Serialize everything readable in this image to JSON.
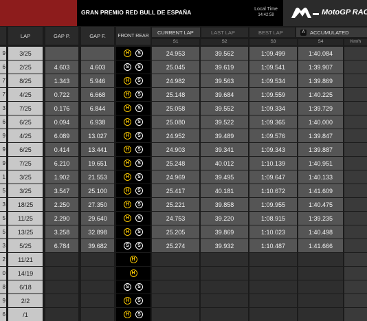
{
  "header": {
    "event_title": "GRAN PREMIO RED BULL DE ESPAÑA",
    "local_time_label": "Local Time",
    "local_time_value": "14:42:58",
    "brand": "MotoGP RAC"
  },
  "columns": {
    "lap": "LAP",
    "gap_prev": "GAP P.",
    "gap_first": "GAP F.",
    "tyres": "FRONT REAR",
    "sectors": [
      "S1",
      "S2",
      "S3",
      "S4"
    ],
    "speed": "Km/h"
  },
  "tabs": {
    "current": "CURRENT LAP",
    "last": "LAST LAP",
    "best": "BEST LAP",
    "accumulated": "ACCUMULATED",
    "accum_icon": "A"
  },
  "colors": {
    "hard_tyre": "#f5c400",
    "soft_tyre": "#ffffff",
    "brand_red": "#8d1c1c"
  },
  "rows": [
    {
      "stub": "9",
      "lap": "3/25",
      "gap_p": "",
      "gap_f": "",
      "front": "H",
      "rear": "S",
      "s1": "24.953",
      "s2": "39.562",
      "s3": "1:09.499",
      "s4": "1:40.084"
    },
    {
      "stub": "6",
      "lap": "2/25",
      "gap_p": "4.603",
      "gap_f": "4.603",
      "front": "S",
      "rear": "S",
      "s1": "25.045",
      "s2": "39.619",
      "s3": "1:09.541",
      "s4": "1:39.907"
    },
    {
      "stub": "7",
      "lap": "8/25",
      "gap_p": "1.343",
      "gap_f": "5.946",
      "front": "H",
      "rear": "S",
      "s1": "24.982",
      "s2": "39.563",
      "s3": "1:09.534",
      "s4": "1:39.869"
    },
    {
      "stub": "7",
      "lap": "4/25",
      "gap_p": "0.722",
      "gap_f": "6.668",
      "front": "H",
      "rear": "S",
      "s1": "25.148",
      "s2": "39.684",
      "s3": "1:09.559",
      "s4": "1:40.225"
    },
    {
      "stub": "3",
      "lap": "7/25",
      "gap_p": "0.176",
      "gap_f": "6.844",
      "front": "H",
      "rear": "S",
      "s1": "25.058",
      "s2": "39.552",
      "s3": "1:09.334",
      "s4": "1:39.729"
    },
    {
      "stub": "6",
      "lap": "6/25",
      "gap_p": "0.094",
      "gap_f": "6.938",
      "front": "H",
      "rear": "S",
      "s1": "25.080",
      "s2": "39.522",
      "s3": "1:09.365",
      "s4": "1:40.000"
    },
    {
      "stub": "9",
      "lap": "4/25",
      "gap_p": "6.089",
      "gap_f": "13.027",
      "front": "H",
      "rear": "S",
      "s1": "24.952",
      "s2": "39.489",
      "s3": "1:09.576",
      "s4": "1:39.847"
    },
    {
      "stub": "9",
      "lap": "6/25",
      "gap_p": "0.414",
      "gap_f": "13.441",
      "front": "H",
      "rear": "S",
      "s1": "24.903",
      "s2": "39.341",
      "s3": "1:09.343",
      "s4": "1:39.887"
    },
    {
      "stub": "9",
      "lap": "7/25",
      "gap_p": "6.210",
      "gap_f": "19.651",
      "front": "H",
      "rear": "S",
      "s1": "25.248",
      "s2": "40.012",
      "s3": "1:10.139",
      "s4": "1:40.951"
    },
    {
      "stub": "1",
      "lap": "3/25",
      "gap_p": "1.902",
      "gap_f": "21.553",
      "front": "H",
      "rear": "S",
      "s1": "24.969",
      "s2": "39.495",
      "s3": "1:09.647",
      "s4": "1:40.133"
    },
    {
      "stub": "5",
      "lap": "3/25",
      "gap_p": "3.547",
      "gap_f": "25.100",
      "front": "H",
      "rear": "S",
      "s1": "25.417",
      "s2": "40.181",
      "s3": "1:10.672",
      "s4": "1:41.609"
    },
    {
      "stub": "3",
      "lap": "18/25",
      "gap_p": "2.250",
      "gap_f": "27.350",
      "front": "H",
      "rear": "S",
      "s1": "25.221",
      "s2": "39.858",
      "s3": "1:09.955",
      "s4": "1:40.475"
    },
    {
      "stub": "5",
      "lap": "11/25",
      "gap_p": "2.290",
      "gap_f": "29.640",
      "front": "H",
      "rear": "S",
      "s1": "24.753",
      "s2": "39.220",
      "s3": "1:08.915",
      "s4": "1:39.235"
    },
    {
      "stub": "5",
      "lap": "13/25",
      "gap_p": "3.258",
      "gap_f": "32.898",
      "front": "H",
      "rear": "S",
      "s1": "25.205",
      "s2": "39.869",
      "s3": "1:10.023",
      "s4": "1:40.498"
    },
    {
      "stub": "3",
      "lap": "5/25",
      "gap_p": "6.784",
      "gap_f": "39.682",
      "front": "S",
      "rear": "S",
      "s1": "25.274",
      "s2": "39.932",
      "s3": "1:10.487",
      "s4": "1:41.666"
    },
    {
      "stub": "2",
      "lap": "11/21",
      "gap_p": "",
      "gap_f": "",
      "front": "H",
      "rear": "",
      "s1": "",
      "s2": "",
      "s3": "",
      "s4": ""
    },
    {
      "stub": "0",
      "lap": "14/19",
      "gap_p": "",
      "gap_f": "",
      "front": "H",
      "rear": "",
      "s1": "",
      "s2": "",
      "s3": "",
      "s4": ""
    },
    {
      "stub": "8",
      "lap": "6/18",
      "gap_p": "",
      "gap_f": "",
      "front": "S",
      "rear": "S",
      "s1": "",
      "s2": "",
      "s3": "",
      "s4": ""
    },
    {
      "stub": "9",
      "lap": "2/2",
      "gap_p": "",
      "gap_f": "",
      "front": "H",
      "rear": "S",
      "s1": "",
      "s2": "",
      "s3": "",
      "s4": ""
    },
    {
      "stub": "6",
      "lap": "/1",
      "gap_p": "",
      "gap_f": "",
      "front": "H",
      "rear": "S",
      "s1": "",
      "s2": "",
      "s3": "",
      "s4": ""
    }
  ]
}
